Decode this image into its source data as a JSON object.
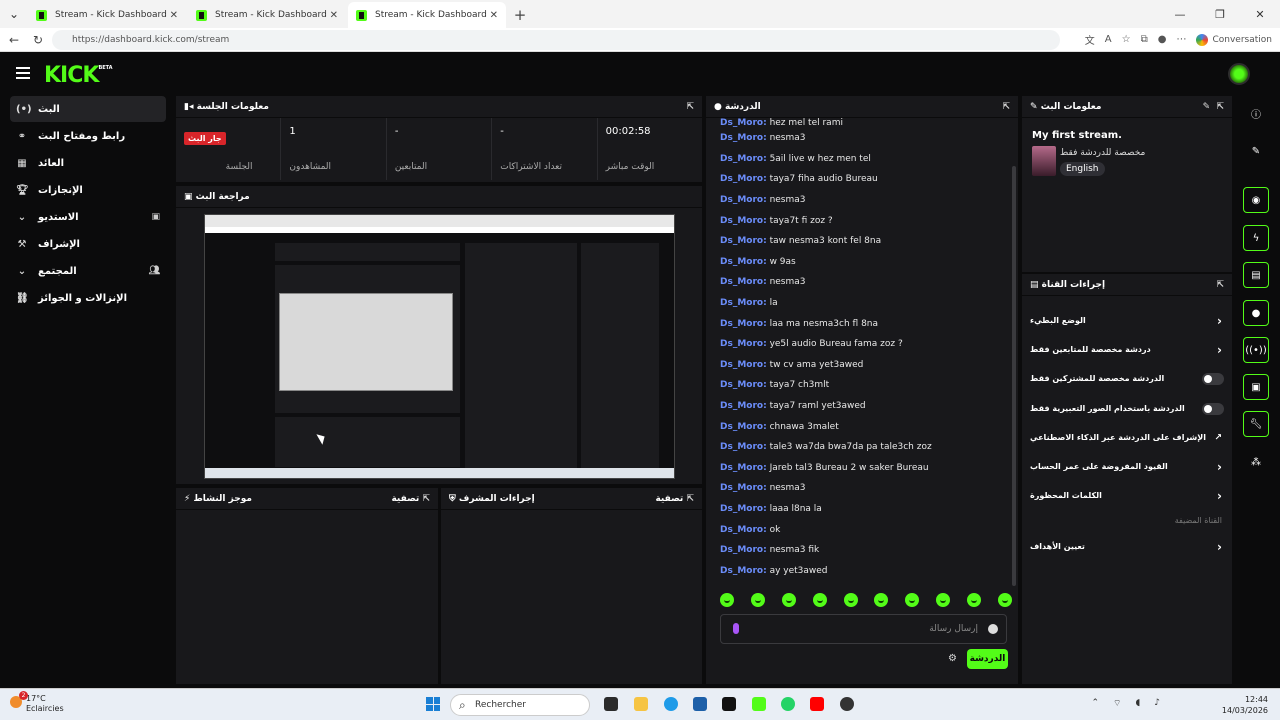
{
  "browser": {
    "tabs": [
      {
        "title": "Stream - Kick Dashboard"
      },
      {
        "title": "Stream - Kick Dashboard"
      },
      {
        "title": "Stream - Kick Dashboard"
      }
    ],
    "url": "https://dashboard.kick.com/stream",
    "conversation_label": "Conversation"
  },
  "app": {
    "logo": "KICK",
    "logo_badge": "BETA"
  },
  "sidebar": {
    "items": [
      {
        "label": "البث",
        "icon": "broadcast-icon"
      },
      {
        "label": "رابط ومفتاح البث",
        "icon": "link-icon"
      },
      {
        "label": "العائد",
        "icon": "revenue-icon"
      },
      {
        "label": "الإنجازات",
        "icon": "trophy-icon"
      },
      {
        "label": "الاستديو",
        "icon": "chevron-down-icon"
      },
      {
        "label": "الإشراف",
        "icon": "moderation-icon"
      },
      {
        "label": "المجتمع",
        "icon": "chevron-down-icon"
      },
      {
        "label": "الإنزالات و الجوائز",
        "icon": "drops-icon"
      }
    ]
  },
  "session": {
    "title": "معلومات الجلسة",
    "live_badge": "جار البث",
    "session_label": "الجلسة",
    "cells": [
      {
        "value": "1",
        "label": "المشاهدون"
      },
      {
        "value": "-",
        "label": "المتابعين"
      },
      {
        "value": "-",
        "label": "تعداد الاشتراكات"
      },
      {
        "value": "00:02:58",
        "label": "الوقت مباشر"
      }
    ]
  },
  "preview": {
    "title": "مراجعة البث"
  },
  "activity": {
    "title": "موجز النشاط",
    "filter": "تصفية"
  },
  "modactions": {
    "title": "إجراءات المشرف",
    "filter": "تصفية"
  },
  "chat": {
    "title": "الدردشة",
    "messages": [
      {
        "user": "Ds_Moro:",
        "text": "hez mel tel rami"
      },
      {
        "user": "Ds_Moro:",
        "text": "nesma3"
      },
      {
        "user": "Ds_Moro:",
        "text": "5ail live w hez men tel"
      },
      {
        "user": "Ds_Moro:",
        "text": "taya7 fiha audio Bureau"
      },
      {
        "user": "Ds_Moro:",
        "text": "nesma3"
      },
      {
        "user": "Ds_Moro:",
        "text": "taya7t fi zoz ?"
      },
      {
        "user": "Ds_Moro:",
        "text": "taw nesma3 kont fel 8na"
      },
      {
        "user": "Ds_Moro:",
        "text": "w 9as"
      },
      {
        "user": "Ds_Moro:",
        "text": "nesma3"
      },
      {
        "user": "Ds_Moro:",
        "text": "la"
      },
      {
        "user": "Ds_Moro:",
        "text": "laa ma nesma3ch fl 8na"
      },
      {
        "user": "Ds_Moro:",
        "text": "ye5l audio Bureau fama zoz ?"
      },
      {
        "user": "Ds_Moro:",
        "text": "tw cv ama yet3awed"
      },
      {
        "user": "Ds_Moro:",
        "text": "taya7 ch3mlt"
      },
      {
        "user": "Ds_Moro:",
        "text": "taya7 raml yet3awed"
      },
      {
        "user": "Ds_Moro:",
        "text": "chnawa 3malet"
      },
      {
        "user": "Ds_Moro:",
        "text": "tale3 wa7da bwa7da pa tale3ch zoz"
      },
      {
        "user": "Ds_Moro:",
        "text": "Jareb tal3 Bureau 2 w saker Bureau"
      },
      {
        "user": "Ds_Moro:",
        "text": "nesma3"
      },
      {
        "user": "Ds_Moro:",
        "text": "laaa l8na la"
      },
      {
        "user": "Ds_Moro:",
        "text": "ok"
      },
      {
        "user": "Ds_Moro:",
        "text": "nesma3 fik"
      },
      {
        "user": "Ds_Moro:",
        "text": "ay yet3awed"
      }
    ],
    "input_placeholder": "إرسال رسالة",
    "send_label": "الدردشة"
  },
  "stream_info": {
    "title": "معلومات البث",
    "stream_title": "My first stream.",
    "category": "مخصصة للدردشة فقط",
    "language": "English"
  },
  "channel_actions": {
    "title": "إجراءات القناة",
    "items": [
      {
        "label": "الوضع البطيء",
        "control": "chevron"
      },
      {
        "label": "دردشة مخصصة للمتابعين فقط",
        "control": "chevron"
      },
      {
        "label": "الدردشة مخصصة للمشتركين فقط",
        "control": "toggle"
      },
      {
        "label": "الدردشة باستخدام الصور التعبيرية فقط",
        "control": "toggle"
      },
      {
        "label": "الإشراف على الدردشة عبر الذكاء الاصطناعي",
        "control": "external"
      },
      {
        "label": "القيود المفروضة على عمر الحساب",
        "control": "chevron"
      },
      {
        "label": "الكلمات المحظورة",
        "control": "chevron"
      }
    ],
    "section_label": "القناة المضيفة",
    "goals_label": "تعيين الأهداف"
  },
  "taskbar": {
    "temperature": "17°C",
    "weather": "Eclaircies",
    "notif_count": "2",
    "search_label": "Rechercher",
    "time": "12:44",
    "date": "14/03/2026"
  },
  "colors": {
    "accent": "#53fc18",
    "username": "#6b8dfa",
    "live": "#d8252a",
    "panel": "#18181b",
    "background": "#0b0b0c"
  }
}
